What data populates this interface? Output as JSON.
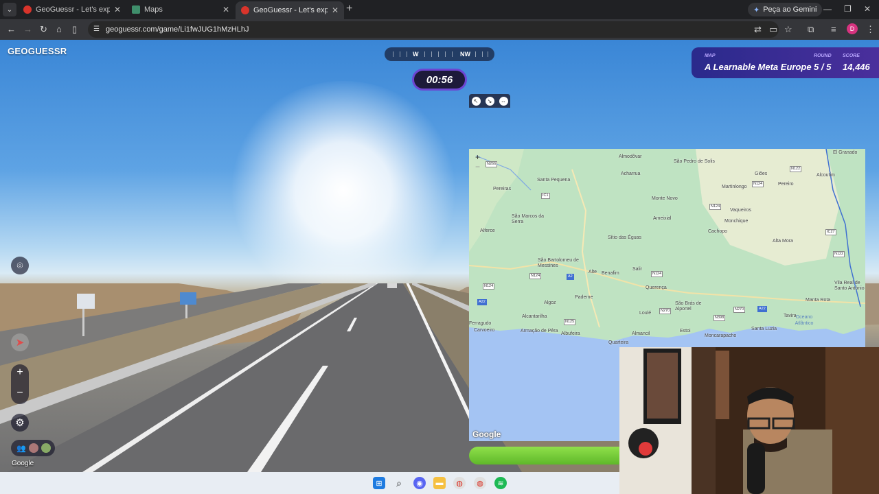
{
  "browser": {
    "tabs": [
      {
        "title": "GeoGuessr - Let's explore the w",
        "active": false
      },
      {
        "title": "Maps",
        "active": false
      },
      {
        "title": "GeoGuessr - Let's explore the w",
        "active": true
      }
    ],
    "gemini_label": "Peça ao Gemini",
    "url": "geoguessr.com/game/Li1fwJUG1hMzHLhJ",
    "profile_initial": "D"
  },
  "game": {
    "logo": "GEOGUESSR",
    "compass": {
      "labels": [
        "W",
        "NW"
      ]
    },
    "timer": "00:56",
    "status": {
      "map_caption": "MAP",
      "map_name": "A Learnable Meta Europe",
      "round_caption": "ROUND",
      "round_value": "5 / 5",
      "score_caption": "SCORE",
      "score_value": "14,446"
    },
    "streetview_attribution": "Google",
    "map_attribution": "Google"
  },
  "map_labels": {
    "towns": [
      "El Granado",
      "Almodôvar",
      "São Pedro de Solis",
      "Giões",
      "Alcoutim",
      "Acharrua",
      "Santa Pequena",
      "Pereiras",
      "Martinlongo",
      "Pereiro",
      "Monte Novo",
      "São Marcos da Serra",
      "Vaqueiros",
      "Ameixial",
      "Monchique",
      "Alferce",
      "Sítio das Éguas",
      "Cachopo",
      "Alta Mora",
      "São Bartolomeu de Messines",
      "Alte",
      "Benafim",
      "Salir",
      "Vila Real de Santo António",
      "Querença",
      "Paderne",
      "Algoz",
      "São Brás de Alportel",
      "Loulé",
      "Manta Rota",
      "Ferragudo",
      "Carvoeiro",
      "Alcantarilha",
      "Armação de Pêra",
      "Albufeira",
      "Almancil",
      "Estoi",
      "Moncarapacho",
      "Tavira",
      "Santa Luzia",
      "Quarteira",
      "Oceano Atlântico"
    ],
    "roads": [
      "N266",
      "N122",
      "N124",
      "IC1",
      "N124",
      "IC27",
      "N122",
      "N124",
      "A2",
      "N124",
      "A22",
      "N124",
      "N125",
      "N270",
      "N270",
      "N398",
      "A22"
    ]
  },
  "taskbar": {
    "apps": [
      "windows-start",
      "search",
      "discord",
      "file-explorer",
      "chrome",
      "chrome",
      "spotify"
    ]
  }
}
